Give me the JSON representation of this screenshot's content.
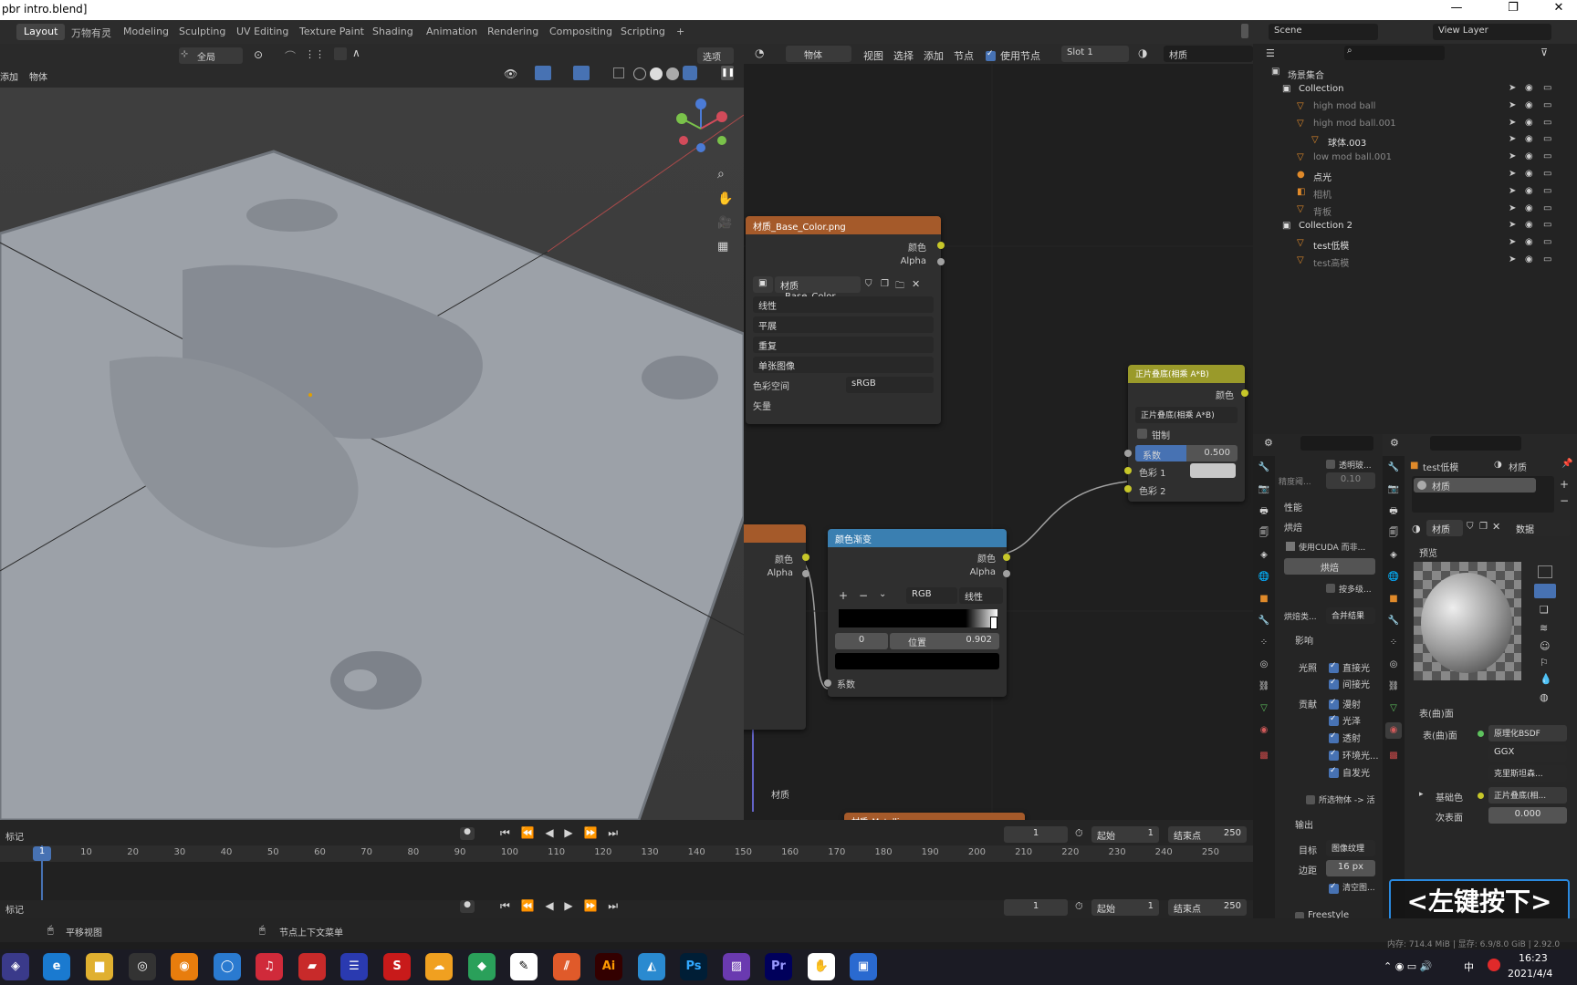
{
  "window": {
    "title": "pbr intro.blend]",
    "min": "—",
    "max": "❐",
    "close": "✕"
  },
  "workspaces": [
    "Layout",
    "万物有灵",
    "Modeling",
    "Sculpting",
    "UV Editing",
    "Texture Paint",
    "Shading",
    "Animation",
    "Rendering",
    "Compositing",
    "Scripting",
    "+"
  ],
  "scene": {
    "label": "Scene",
    "view_layer": "View Layer"
  },
  "viewport": {
    "transform": "全局",
    "options": "选项",
    "menu_add": "添加",
    "menu_object": "物体"
  },
  "node_editor": {
    "mode": "物体",
    "menus": [
      "视图",
      "选择",
      "添加",
      "节点"
    ],
    "use_nodes": "使用节点",
    "slot": "Slot 1",
    "material": "材质",
    "img_node": {
      "title": "材质_Base_Color.png",
      "out_color": "颜色",
      "out_alpha": "Alpha",
      "image": "材质_Base_Color...",
      "interp": "线性",
      "proj": "平展",
      "ext": "重复",
      "source": "单张图像",
      "cs_label": "色彩空间",
      "cs_value": "sRGB",
      "vector": "矢量"
    },
    "mix_node": {
      "title": "正片叠底(相乘 A*B)",
      "out_color": "颜色",
      "mode": "正片叠底(相乘 A*B)",
      "clamp": "钳制",
      "fac_label": "系数",
      "fac_value": "0.500",
      "c1": "色彩 1",
      "c2": "色彩 2"
    },
    "ramp_node": {
      "title": "颜色渐变",
      "out_color": "颜色",
      "out_alpha": "Alpha",
      "mode": "RGB",
      "interp": "线性",
      "index": "0",
      "pos_label": "位置",
      "pos_value": "0.902",
      "fac": "系数"
    },
    "left_node": {
      "out_color": "颜色",
      "out_alpha": "Alpha"
    },
    "bottom_node": "材质_Metallic.png",
    "frame_label": "材质"
  },
  "outliner": {
    "root": "场景集合",
    "items": [
      {
        "name": "Collection",
        "indent": 0
      },
      {
        "name": "high mod ball",
        "indent": 1
      },
      {
        "name": "high mod ball.001",
        "indent": 1
      },
      {
        "name": "球体.003",
        "indent": 2
      },
      {
        "name": "low mod ball.001",
        "indent": 1
      },
      {
        "name": "点光",
        "indent": 1
      },
      {
        "name": "相机",
        "indent": 1
      },
      {
        "name": "背板",
        "indent": 1
      },
      {
        "name": "Collection 2",
        "indent": 0
      },
      {
        "name": "test低模",
        "indent": 1
      },
      {
        "name": "test高模",
        "indent": 1
      }
    ]
  },
  "render_props": {
    "transp": "透明玻...",
    "precision_label": "精度阈...",
    "precision": "0.10",
    "perf": "性能",
    "bake": "烘焙",
    "cuda": "使用CUDA 而非...",
    "bake_btn": "烘焙",
    "multires": "按多级...",
    "bake_type_label": "烘焙类...",
    "bake_type": "合并结果",
    "influence": "影响",
    "lighting": "光照",
    "direct": "直接光",
    "indirect": "间接光",
    "contrib": "贡献",
    "diffuse": "漫射",
    "gloss": "光泽",
    "transmission": "透射",
    "ambient": "环境光...",
    "emit": "自发光",
    "selected": "所选物体 -> 活",
    "output": "输出",
    "target_label": "目标",
    "target": "图像纹理",
    "margin_label": "边距",
    "margin": "16 px",
    "clear": "清空图...",
    "freestyle": "Freestyle"
  },
  "material_props": {
    "object": "test低模",
    "tab": "材质",
    "slot": "材质",
    "mat_name": "材质",
    "data": "数据",
    "preview": "预览",
    "surface": "表(曲)面",
    "surface_label": "表(曲)面",
    "shader": "原理化BSDF",
    "dist": "GGX",
    "sss": "克里斯坦森...",
    "base_color_label": "基础色",
    "base_color": "正片叠底(相...",
    "subsurface_label": "次表面",
    "subsurface": "0.000"
  },
  "timeline": {
    "label": "标记",
    "frame": "1",
    "start_label": "起始",
    "start": "1",
    "end_label": "结束点",
    "end": "250",
    "ticks": [
      "1",
      "10",
      "20",
      "30",
      "40",
      "50",
      "60",
      "70",
      "80",
      "90",
      "100",
      "110",
      "120",
      "130",
      "140",
      "150",
      "160",
      "170",
      "180",
      "190",
      "200",
      "210",
      "220",
      "230",
      "240",
      "250"
    ]
  },
  "status": {
    "pan": "平移视图",
    "ctx": "节点上下文菜单",
    "mem": "内存: 714.4 MiB | 显存: 6.9/8.0 GiB | 2.92.0"
  },
  "overlay": "<左键按下>",
  "taskbar": {
    "time": "16:23",
    "date": "2021/4/4",
    "ime": "中"
  }
}
